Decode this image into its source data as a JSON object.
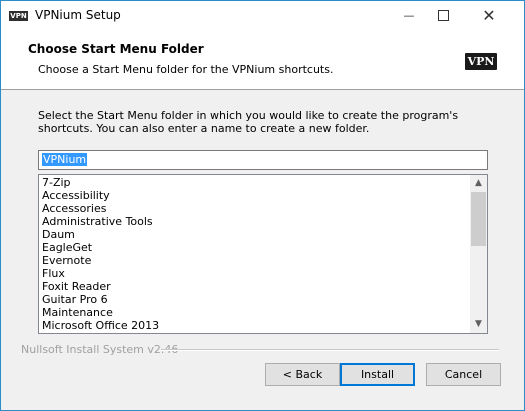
{
  "window": {
    "title": "VPNium  Setup",
    "app_icon_text": "VPN",
    "minimize_glyph": "—",
    "close_glyph": "✕"
  },
  "header": {
    "title": "Choose Start Menu Folder",
    "subtitle": "Choose a Start Menu folder for the VPNium  shortcuts.",
    "logo_text": "VPN"
  },
  "body": {
    "instructions": "Select the Start Menu folder in which you would like to create the program's shortcuts. You can also enter a name to create a new folder.",
    "folder_input": {
      "value": "VPNium"
    },
    "folders": [
      "7-Zip",
      "Accessibility",
      "Accessories",
      "Administrative Tools",
      "Daum",
      "EagleGet",
      "Evernote",
      "Flux",
      "Foxit Reader",
      "Guitar Pro 6",
      "Maintenance",
      "Microsoft Office 2013"
    ],
    "scroll_up_glyph": "▲",
    "scroll_down_glyph": "▼"
  },
  "footer": {
    "brand": "Nullsoft Install System v2.46",
    "back_label": "< Back",
    "install_label": "Install",
    "cancel_label": "Cancel"
  },
  "colors": {
    "desktop": "#3a9fd8",
    "selection": "#3399ff",
    "focus_border": "#0078d7"
  }
}
